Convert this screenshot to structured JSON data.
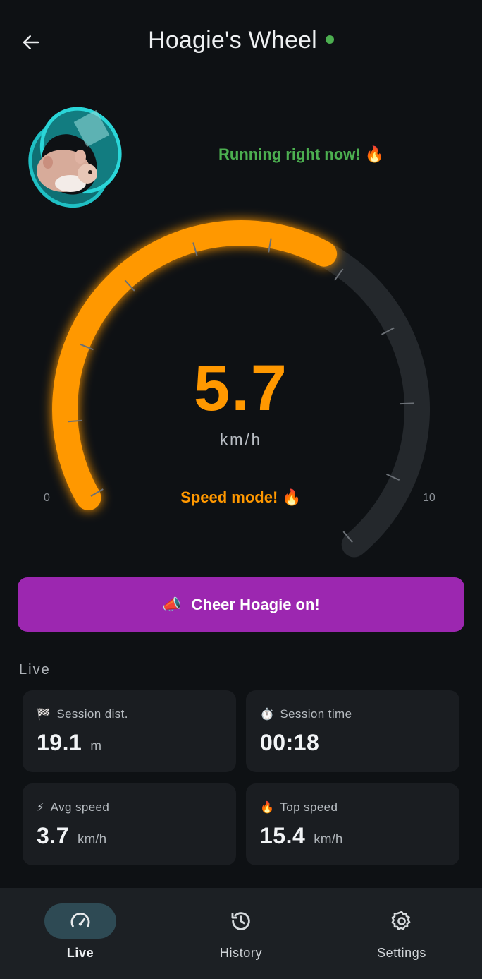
{
  "header": {
    "title": "Hoagie's Wheel",
    "online_color": "#4caf50"
  },
  "status": {
    "text": "Running right now! 🔥"
  },
  "gauge": {
    "value": "5.7",
    "unit": "km/h",
    "mode": "Speed mode! 🔥",
    "min_label": "0",
    "max_label": "10",
    "min": 0,
    "max": 10,
    "current": 5.7,
    "accent_color": "#ff9800",
    "track_color": "#24282c"
  },
  "cheer": {
    "emoji": "📣",
    "label": "Cheer Hoagie on!",
    "color": "#9c27b0"
  },
  "live": {
    "section_label": "Live",
    "cards": [
      {
        "icon": "checkered-flag-icon",
        "emoji": "🏁",
        "label": "Session dist.",
        "value": "19.1",
        "unit": "m"
      },
      {
        "icon": "stopwatch-icon",
        "emoji": "⏱️",
        "label": "Session time",
        "value": "00:18",
        "unit": ""
      },
      {
        "icon": "lightning-icon",
        "emoji": "⚡",
        "label": "Avg speed",
        "value": "3.7",
        "unit": "km/h"
      },
      {
        "icon": "fire-icon",
        "emoji": "🔥",
        "label": "Top speed",
        "value": "15.4",
        "unit": "km/h"
      }
    ]
  },
  "nav": {
    "items": [
      {
        "label": "Live",
        "icon": "speedometer-icon",
        "active": true
      },
      {
        "label": "History",
        "icon": "history-icon",
        "active": false
      },
      {
        "label": "Settings",
        "icon": "gear-icon",
        "active": false
      }
    ]
  }
}
